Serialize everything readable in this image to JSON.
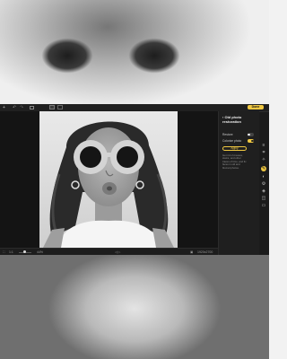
{
  "toolbar": {
    "done_label": "Done",
    "icons": [
      "plus-icon",
      "undo-icon",
      "redo-icon",
      "grid-icon",
      "single-view-icon",
      "split-view-icon"
    ]
  },
  "panel": {
    "title": "Old photo restoration",
    "rows": [
      {
        "label": "Restore",
        "state": "off"
      },
      {
        "label": "Colorize photo",
        "state": "on"
      }
    ],
    "apply_label": "Apply",
    "hint": "Get rid of creases, stains, and other traces of time, and fix faces in old and blurred photos."
  },
  "tools": [
    "presets-icon",
    "crop-icon",
    "enhance-icon",
    "ai-tools-icon",
    "adjust-icon",
    "retouch-icon",
    "layers-icon",
    "mask-icon",
    "export-icon"
  ],
  "bottombar": {
    "zoom_value": "44%",
    "compare_label": "◁ ▷",
    "dimensions": "1920x2700"
  },
  "colors": {
    "accent": "#f0c842",
    "panel_bg": "#1f1f1f",
    "canvas_bg": "#141414"
  }
}
